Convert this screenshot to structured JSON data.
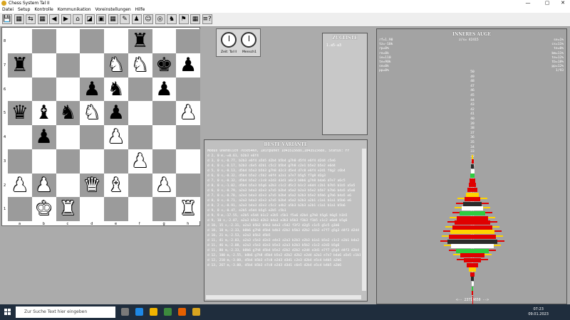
{
  "window": {
    "title": "Chess System Tal II",
    "controls": [
      "—",
      "▢",
      "✕"
    ]
  },
  "menu": [
    "Datei",
    "Setup",
    "Kontrolle",
    "Kommunikation",
    "Voreinstellungen",
    "Hilfe"
  ],
  "toolbar": {
    "buttons": [
      "💾",
      "▦",
      "⇆",
      "▦",
      "◀",
      "▶",
      "⌂",
      "◪",
      "▣",
      "▦",
      "✎",
      "♟",
      "☺",
      "◎",
      "♞",
      "⚑",
      "▦",
      "≡?"
    ]
  },
  "board": {
    "ranks": [
      "8",
      "7",
      "6",
      "5",
      "4",
      "3",
      "2",
      "1"
    ],
    "files": [
      "a",
      "b",
      "c",
      "d",
      "e",
      "f",
      "g",
      "h"
    ],
    "pieces": [
      {
        "sq": "f8",
        "glyph": "♜",
        "color": "b"
      },
      {
        "sq": "a7",
        "glyph": "♜",
        "color": "b"
      },
      {
        "sq": "e7",
        "glyph": "♞",
        "color": "w"
      },
      {
        "sq": "f7",
        "glyph": "♞",
        "color": "w"
      },
      {
        "sq": "g7",
        "glyph": "♚",
        "color": "b"
      },
      {
        "sq": "h7",
        "glyph": "♟",
        "color": "b"
      },
      {
        "sq": "d6",
        "glyph": "♟",
        "color": "b"
      },
      {
        "sq": "e6",
        "glyph": "♞",
        "color": "b"
      },
      {
        "sq": "g6",
        "glyph": "♟",
        "color": "b"
      },
      {
        "sq": "a5",
        "glyph": "♛",
        "color": "b"
      },
      {
        "sq": "b5",
        "glyph": "♝",
        "color": "b"
      },
      {
        "sq": "c5",
        "glyph": "♞",
        "color": "b"
      },
      {
        "sq": "d5",
        "glyph": "♞",
        "color": "w"
      },
      {
        "sq": "e5",
        "glyph": "♟",
        "color": "b"
      },
      {
        "sq": "h5",
        "glyph": "♟",
        "color": "w"
      },
      {
        "sq": "b4",
        "glyph": "♟",
        "color": "b"
      },
      {
        "sq": "e4",
        "glyph": "♟",
        "color": "w"
      },
      {
        "sq": "f3",
        "glyph": "♟",
        "color": "w"
      },
      {
        "sq": "a2",
        "glyph": "♟",
        "color": "w"
      },
      {
        "sq": "b2",
        "glyph": "♟",
        "color": "w"
      },
      {
        "sq": "d2",
        "glyph": "♛",
        "color": "w"
      },
      {
        "sq": "e2",
        "glyph": "♝",
        "color": "w"
      },
      {
        "sq": "g2",
        "glyph": "♟",
        "color": "w"
      },
      {
        "sq": "b1",
        "glyph": "♚",
        "color": "w"
      },
      {
        "sq": "c1",
        "glyph": "♜",
        "color": "w"
      },
      {
        "sq": "h1",
        "glyph": "♜",
        "color": "w"
      }
    ]
  },
  "clocks": {
    "left_label": "Zeit: Tal II",
    "right_label": "Mensch1"
  },
  "zugliste": {
    "title": "ZUGLISTE",
    "moves": "1.a5-a3"
  },
  "variante": {
    "title": "BESTE VARIANTE",
    "status": "Modus Unendlich 765054Kn, Zeitpunkt 104351568s,104351568s, Status: Fr",
    "lines": [
      "d 2, 0 m,-=0.61, b2b3 e6f4",
      "d 3, 0 s,-0.77, b2b3 e6f4 a5b5 d2b4 b5b4 g7h8 d5f4 e6f4 d2d4 c5e6",
      "d 4, 0 s,-0.17, b2b3 c6e5 d2b1 c5c2 b5b4 g7h8 c2e1 b5e2 b5e2 e6d4",
      "d 5, 0 s,-0.13, d5b4 b5a3 b5b3 g7h8 d2c3 d5e4 d7c8 e6f4 e2d1 f4g2 c6b4",
      "d 6, 0 s,-0.32, d5b4 b5a2 c5b2 e6f4 a2a1 a7e7 b5g5 f7g8 d2g3",
      "d 7, 0 s,-0.32, d5b4 b5a2 c1c8 e2d3 d3d1 a6c3 b8b6 g7h8 b4a6 d7e7 a6c5",
      "d 8, 0 s,-1.02, d5b4 b5a3 b5g6 a2b3 c1c2 d5c2 b1c2 e6d4 c2b1 b7b5 b1b5 a5a5",
      "d 6, 0 s,-0.79, a2a3 b4a3 d2e3 a7a5 b2b4 a5a2 b2a3 b5e2 b5b7 b7b6 b4a5 a5a6",
      "d 7, 0 s,-0.78, a2a3 b4a3 d2e3 a7a5 b2b4 a5a2 b2b3 b5e2 b5b6 g7b6 b4a5 e6",
      "d 8, 0 s,-0.71, a2a3 b4a3 d2e3 a7a5 b2b4 a5a2 b2b3 a2b1 c1a1 b1a1 b5b6 e6",
      "d 8, 2 s,-0.91, a2a3 b4a3 d2e3 c5c2 a4b2 a5b3 b2b3 a2b1 c1a1 b1a1 b5b6",
      "d 9, 8 s,-0.47, e2b5 e5d4 b5g5 e2b5 c5b1",
      "d 9, 9 m,-17.55, e2b5 e5d4 b1c2 e2b5 c5b1 f5a6 d2b4 g7h8 h5g6 h6g5 h1h5",
      "d 9, 10 s,-2.07, a2a3 b5b3 d2b3 b4a3 e3b3 b5b3 f3b3 f1b5 c1c2 e6d4 b5g6",
      "d 10, 15 s,-2.31, a2a3 b5b2 b5b3 b4a3 c5d2 f3f2 d2g5 c1c5 g5c5 g1b6",
      "d 10, 18 m,-2.33, b8b6 g7h8 d5b4 b4b3 d2b2 b5b3 d2b2 a1b2 e7f7 g5g3 d4f3 d2d4",
      "d 10, 21 m,-2.53, a2a3 b5b3 d5b5",
      "d 11, 41 m,-2.03, a2a3 c5e3 d2e3 e4e3 a2a3 b2b3 e2b3 b1a1 b5e2 c1c2 e2b1 b4a2 b5e2",
      "d 11, 46 m,-2.08, a2a3 c5e3 d2e3 b5e3 a2a3 b2b3 b5b2 c1c2 e2d3 b5g6",
      "d 11, 80 m,-2.33, b8b6 g7h8 d5b4 b5e2 d2b2 d2b2 e2d4 e3d1 e7f7 g5g4 d4f3 d2b4",
      "d 12, 100 m,-2.55, b8b6 g7h8 d5b4 b5e2 d2b2 d2b2 e2d4 a2a1 e7e7 b4a6 a5e5 c1b1",
      "d 12, 210 m,-3.00, d5b4 b5b3 e7c8 e2d3 d3d1 c2e3 d2b4 e5c4 b4b5 a2b6",
      "d 13, 267 m,-3.00, d5b4 b5b3 e7c8 e2d3 d3d1 c6e5 d2b4 e5c4 b4b5 a2b6"
    ]
  },
  "auge": {
    "title": "INNERES AUGE",
    "center_value": "z/s= 42415",
    "left_stats": [
      "rf=1.90",
      "tz=-10k",
      "rp=0%",
      "re=0k",
      "ie=110",
      "te=90k",
      "se=0k",
      "pp=0%"
    ],
    "right_stats": [
      "se=1%",
      "cs=11%",
      "te=0%",
      "bm=11%",
      "te=12%",
      "tb=18%",
      "pp=12%",
      "1/93"
    ],
    "depth_labels": [
      "50",
      "49",
      "48",
      "47",
      "46",
      "45",
      "44",
      "43",
      "42",
      "41",
      "40",
      "39",
      "38",
      "37",
      "36",
      "35",
      "34",
      "33",
      "32",
      "31",
      "30",
      "29",
      "28",
      "27",
      "26",
      "25",
      "24",
      "23",
      "22",
      "21",
      "20",
      "19",
      "18",
      "17",
      "16",
      "15",
      "14",
      "13",
      "12",
      "11",
      "10",
      "9",
      "8",
      "7",
      "6",
      "5",
      "4",
      "3",
      "2",
      "1",
      "0"
    ],
    "footer": "<-- 23714650 -->"
  },
  "taskbar": {
    "search_placeholder": "Zur Suche Text hier eingeben",
    "time": "07:23",
    "date": "09.01.2023"
  }
}
